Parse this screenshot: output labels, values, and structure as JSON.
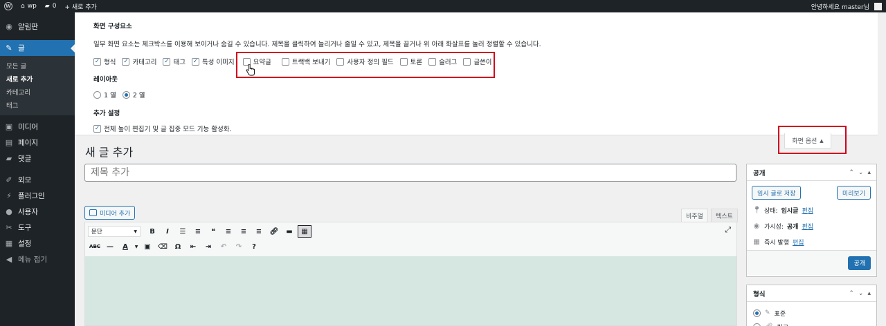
{
  "adminbar": {
    "site_name": "wp",
    "comments_count": "0",
    "new_label": "+ 새로 추가",
    "greeting": "안녕하세요 master님"
  },
  "sidebar": {
    "items": [
      {
        "label": "알림판",
        "icon": "dashboard-icon",
        "glyph": "◉"
      },
      {
        "label": "글",
        "icon": "pin-icon",
        "glyph": "✎"
      },
      {
        "label": "미디어",
        "icon": "media-icon",
        "glyph": "▣"
      },
      {
        "label": "페이지",
        "icon": "page-icon",
        "glyph": "▤"
      },
      {
        "label": "댓글",
        "icon": "comment-icon",
        "glyph": "▰"
      },
      {
        "label": "외모",
        "icon": "appearance-icon",
        "glyph": "✐"
      },
      {
        "label": "플러그인",
        "icon": "plugin-icon",
        "glyph": "⚡"
      },
      {
        "label": "사용자",
        "icon": "user-icon",
        "glyph": "●"
      },
      {
        "label": "도구",
        "icon": "tools-icon",
        "glyph": "✂"
      },
      {
        "label": "설정",
        "icon": "settings-icon",
        "glyph": "▦"
      },
      {
        "label": "메뉴 접기",
        "icon": "collapse-icon",
        "glyph": "◀"
      }
    ],
    "submenu": [
      "모든 글",
      "새로 추가",
      "카테고리",
      "태그"
    ]
  },
  "screen_options": {
    "heading": "화면 구성요소",
    "description": "일부 화면 요소는 체크박스를 이용해 보이거나 숨길 수 있습니다. 제목을 클릭하여 늘리거나 줄일 수 있고, 제목을 끌거나 위 아래 화살표를 눌러 정렬할 수 있습니다.",
    "boxes": [
      {
        "label": "형식",
        "checked": true
      },
      {
        "label": "카테고리",
        "checked": true
      },
      {
        "label": "태그",
        "checked": true
      },
      {
        "label": "특성 이미지",
        "checked": true
      },
      {
        "label": "요약글",
        "checked": false
      },
      {
        "label": "트랙백 보내기",
        "checked": false
      },
      {
        "label": "사용자 정의 필드",
        "checked": false
      },
      {
        "label": "토론",
        "checked": false
      },
      {
        "label": "슬러그",
        "checked": false
      },
      {
        "label": "글쓴이",
        "checked": false
      }
    ],
    "layout_heading": "레이아웃",
    "layout_options": [
      {
        "label": "1 열",
        "selected": false
      },
      {
        "label": "2 열",
        "selected": true
      }
    ],
    "extra_heading": "추가 설정",
    "extra_label": "전체 높이 편집기 및 글 집중 모드 기능 활성화.",
    "tab_label": "화면 옵션"
  },
  "main": {
    "page_title": "새 글 추가",
    "title_placeholder": "제목 추가",
    "media_button": "미디어 추가",
    "tab_visual": "비주얼",
    "tab_text": "텍스트",
    "format_select": "문단"
  },
  "publish": {
    "title": "공개",
    "save_draft": "임시 글로 저장",
    "preview": "미리보기",
    "status_label": "상태:",
    "status_value": "임시글",
    "visibility_label": "가시성:",
    "visibility_value": "공개",
    "schedule_label": "즉시 발행",
    "edit_link": "편집",
    "publish_button": "공개"
  },
  "format_box": {
    "title": "형식",
    "options": [
      "표준",
      "링크"
    ]
  },
  "colors": {
    "accent": "#2271b1",
    "adminbar": "#1d2327",
    "highlight": "#d0021b",
    "editor_bg": "#d6e7e1"
  }
}
